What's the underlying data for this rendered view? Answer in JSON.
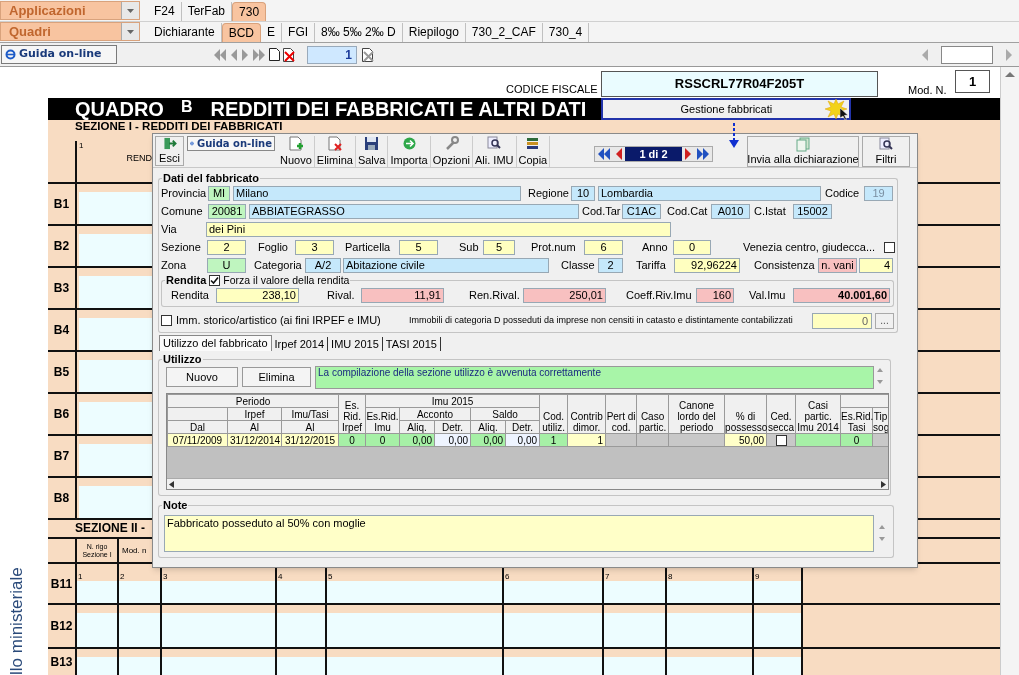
{
  "menus": [
    {
      "label": "Applicazioni",
      "tabs": [
        {
          "label": "F24",
          "selected": false
        },
        {
          "label": "TerFab",
          "selected": false
        },
        {
          "label": "730",
          "selected": true
        }
      ]
    },
    {
      "label": "Quadri",
      "tabs": [
        {
          "label": "Dichiarante",
          "selected": false
        },
        {
          "label": "BCD",
          "selected": true
        },
        {
          "label": "E",
          "selected": false
        },
        {
          "label": "FGI",
          "selected": false
        },
        {
          "label": "8‰ 5‰ 2‰ D",
          "selected": false
        },
        {
          "label": "Riepilogo",
          "selected": false
        },
        {
          "label": "730_2_CAF",
          "selected": false
        },
        {
          "label": "730_4",
          "selected": false
        }
      ]
    }
  ],
  "toolbar": {
    "help_button": "Guida on-line",
    "page": "1"
  },
  "form": {
    "codice_fiscale_label": "CODICE FISCALE",
    "codice_fiscale": "RSSCRL77R04F205T",
    "mod_label": "Mod. N.",
    "mod": "1",
    "title": "QUADRO",
    "title_letter": "B",
    "title_text": "REDDITI DEI FABBRICATI E ALTRI DATI",
    "manage_button": "Gestione fabbricati",
    "section_1": {
      "title": "SEZIONE I - REDDITI DEI FABBRICATI",
      "column_number": "1",
      "column_label": "REND",
      "rows": [
        "B1",
        "B2",
        "B3",
        "B4",
        "B5",
        "B6",
        "B7",
        "B8"
      ]
    },
    "section_2": {
      "title": "SEZIONE II -",
      "column_headers": [
        "N. rigo Sezione I",
        "Mod. n"
      ],
      "column_numbers": [
        "1",
        "2",
        "3",
        "4",
        "5",
        "6",
        "7",
        "8",
        "9"
      ],
      "rows": [
        "B11",
        "B12",
        "B13"
      ]
    },
    "side_caption": "llo ministeriale"
  },
  "dialog": {
    "exit_button": "Esci",
    "help_button": "Guida on-line",
    "actions": [
      "Nuovo",
      "Elimina",
      "Salva",
      "Importa",
      "Opzioni",
      "Ali. IMU",
      "Copia"
    ],
    "record": "1 di 2",
    "send_button": "Invia alla dichiarazione",
    "filter_button": "Filtri",
    "details": {
      "title": "Dati del fabbricato",
      "lines": [
        {
          "items": [
            {
              "kind": "label",
              "text": "Provincia"
            },
            {
              "kind": "field",
              "value": "MI",
              "color": "#bff5bf"
            },
            {
              "kind": "field",
              "value": "Milano",
              "color": "#c5e8fb"
            },
            {
              "kind": "label",
              "text": "Regione"
            },
            {
              "kind": "field",
              "value": "10",
              "color": "#c5e8fb"
            },
            {
              "kind": "field",
              "value": "Lombardia",
              "color": "#c5e8fb"
            },
            {
              "kind": "label",
              "text": "Codice"
            },
            {
              "kind": "field",
              "value": "19",
              "color": "#c5e8fb"
            }
          ]
        },
        {
          "items": [
            {
              "kind": "label",
              "text": "Comune"
            },
            {
              "kind": "field",
              "value": "20081",
              "color": "#bff5bf"
            },
            {
              "kind": "field",
              "value": "ABBIATEGRASSO",
              "color": "#c5e8fb"
            },
            {
              "kind": "label",
              "text": "Cod.Tar"
            },
            {
              "kind": "field",
              "value": "C1AC",
              "color": "#c5e8fb"
            },
            {
              "kind": "label",
              "text": "Cod.Cat"
            },
            {
              "kind": "field",
              "value": "A010",
              "color": "#c5e8fb"
            },
            {
              "kind": "label",
              "text": "C.Istat"
            },
            {
              "kind": "field",
              "value": "15002",
              "color": "#c5e8fb"
            }
          ]
        },
        {
          "items": [
            {
              "kind": "label",
              "text": "Via"
            },
            {
              "kind": "field",
              "value": "dei Pini",
              "color": "#ffffc0"
            }
          ]
        },
        {
          "items": [
            {
              "kind": "label",
              "text": "Sezione"
            },
            {
              "kind": "field",
              "value": "2",
              "color": "#ffffc0"
            },
            {
              "kind": "label",
              "text": "Foglio"
            },
            {
              "kind": "field",
              "value": "3",
              "color": "#ffffc0"
            },
            {
              "kind": "label",
              "text": "Particella"
            },
            {
              "kind": "field",
              "value": "5",
              "color": "#ffffc0"
            },
            {
              "kind": "label",
              "text": "Sub"
            },
            {
              "kind": "field",
              "value": "5",
              "color": "#ffffc0"
            },
            {
              "kind": "label",
              "text": "Prot.num"
            },
            {
              "kind": "field",
              "value": "6",
              "color": "#ffffc0"
            },
            {
              "kind": "label",
              "text": "Anno"
            },
            {
              "kind": "field",
              "value": "0",
              "color": "#ffffc0"
            },
            {
              "kind": "label",
              "text": "Venezia centro, giudecca..."
            },
            {
              "kind": "checkbox",
              "checked": false
            }
          ]
        },
        {
          "items": [
            {
              "kind": "label",
              "text": "Zona"
            },
            {
              "kind": "field",
              "value": "U",
              "color": "#bff5bf"
            },
            {
              "kind": "label",
              "text": "Categoria"
            },
            {
              "kind": "field",
              "value": "A/2",
              "color": "#c5e8fb"
            },
            {
              "kind": "field",
              "value": "Abitazione civile",
              "color": "#c5e8fb"
            },
            {
              "kind": "label",
              "text": "Classe"
            },
            {
              "kind": "field",
              "value": "2",
              "color": "#c5e8fb"
            },
            {
              "kind": "label",
              "text": "Tariffa"
            },
            {
              "kind": "field",
              "value": "92,96224",
              "color": "#ffffc0"
            },
            {
              "kind": "label",
              "text": "Consistenza"
            },
            {
              "kind": "field",
              "value": "n. vani",
              "color": "#f8c0c0"
            },
            {
              "kind": "field",
              "value": "4",
              "color": "#ffffc0"
            }
          ]
        }
      ],
      "rendita": {
        "title": "Rendita",
        "force": {
          "label": "Forza il valore della rendita",
          "checked": true
        },
        "row": [
          {
            "kind": "label",
            "text": "Rendita"
          },
          {
            "kind": "field",
            "value": "238,10",
            "color": "#ffffc0"
          },
          {
            "kind": "label",
            "text": "Rival."
          },
          {
            "kind": "field",
            "value": "11,91",
            "color": "#f8c0c0"
          },
          {
            "kind": "label",
            "text": "Ren.Rival."
          },
          {
            "kind": "field",
            "value": "250,01",
            "color": "#f8c0c0"
          },
          {
            "kind": "label",
            "text": "Coeff.Riv.Imu"
          },
          {
            "kind": "field",
            "value": "160",
            "color": "#f8c0c0"
          },
          {
            "kind": "label",
            "text": "Val.Imu"
          },
          {
            "kind": "field",
            "value": "40.001,60",
            "color": "#f8c0c0"
          }
        ]
      },
      "historic": {
        "label": "Imm. storico/artistico (ai fini IRPEF e IMU)",
        "checked": false
      },
      "category_d": {
        "label": "Immobili di categoria D posseduti da imprese non censiti in catasto e distintamente contabilizzati",
        "value": "0",
        "button": "..."
      }
    },
    "tabs": [
      {
        "label": "Utilizzo del fabbricato",
        "selected": true
      },
      {
        "label": "Irpef 2014",
        "selected": false
      },
      {
        "label": "IMU 2015",
        "selected": false
      },
      {
        "label": "TASI 2015",
        "selected": false
      }
    ],
    "usage": {
      "title": "Utilizzo",
      "buttons": [
        "Nuovo",
        "Elimina"
      ],
      "message": "La compilazione della sezione utilizzo è avvenuta correttamente",
      "header_rows": [
        [
          "Periodo",
          "Es. Rid. Irpef",
          "Imu 2015",
          "Cod. utiliz.",
          "Contrib dimor.",
          "Pert di cod.",
          "Caso partic.",
          "Canone lordo del periodo",
          "% di possesso",
          "Ced. secca",
          "Casi partic. Imu 2014"
        ],
        [
          "Irpef",
          "Imu/Tasi",
          "Es.Rid. Imu",
          "Acconto",
          "Saldo",
          "Es.Rid. Tasi",
          "Tip sog"
        ],
        [
          "Dal",
          "Al",
          "Al",
          "Aliq.",
          "Detr.",
          "Aliq.",
          "Detr."
        ]
      ],
      "rows": [
        [
          {
            "kind": "text",
            "value": "07/11/2009",
            "color": "#ffffc8"
          },
          {
            "kind": "text",
            "value": "31/12/2014",
            "color": "#ffffc8"
          },
          {
            "kind": "text",
            "value": "31/12/2015",
            "color": "#ffffc8"
          },
          {
            "kind": "text",
            "value": "0",
            "color": "#a6f0a6"
          },
          {
            "kind": "text",
            "value": "0",
            "color": "#a6f0a6"
          },
          {
            "kind": "text",
            "value": "0,00",
            "color": "#a6f0a6"
          },
          {
            "kind": "text",
            "value": "0,00",
            "color": "#eef4ff"
          },
          {
            "kind": "text",
            "value": "0,00",
            "color": "#a6f0a6"
          },
          {
            "kind": "text",
            "value": "0,00",
            "color": "#eef4ff"
          },
          {
            "kind": "text",
            "value": "1",
            "color": "#a6f0a6"
          },
          {
            "kind": "text",
            "value": "1",
            "color": "#ffffc8"
          },
          {
            "kind": "empty",
            "color": "#c8c8c8"
          },
          {
            "kind": "empty",
            "color": "#c8c8c8"
          },
          {
            "kind": "empty",
            "color": "#c8c8c8"
          },
          {
            "kind": "text",
            "value": "50,00",
            "color": "#ffffc8"
          },
          {
            "kind": "checkbox",
            "checked": false,
            "color": "#c8c8c8"
          },
          {
            "kind": "empty",
            "color": "#a6f0a6"
          },
          {
            "kind": "text",
            "value": "0",
            "color": "#a6f0a6"
          },
          {
            "kind": "empty",
            "color": "#c8c8c8"
          }
        ]
      ]
    },
    "note": {
      "title": "Note",
      "text": "Fabbricato posseduto al 50% con moglie"
    }
  }
}
